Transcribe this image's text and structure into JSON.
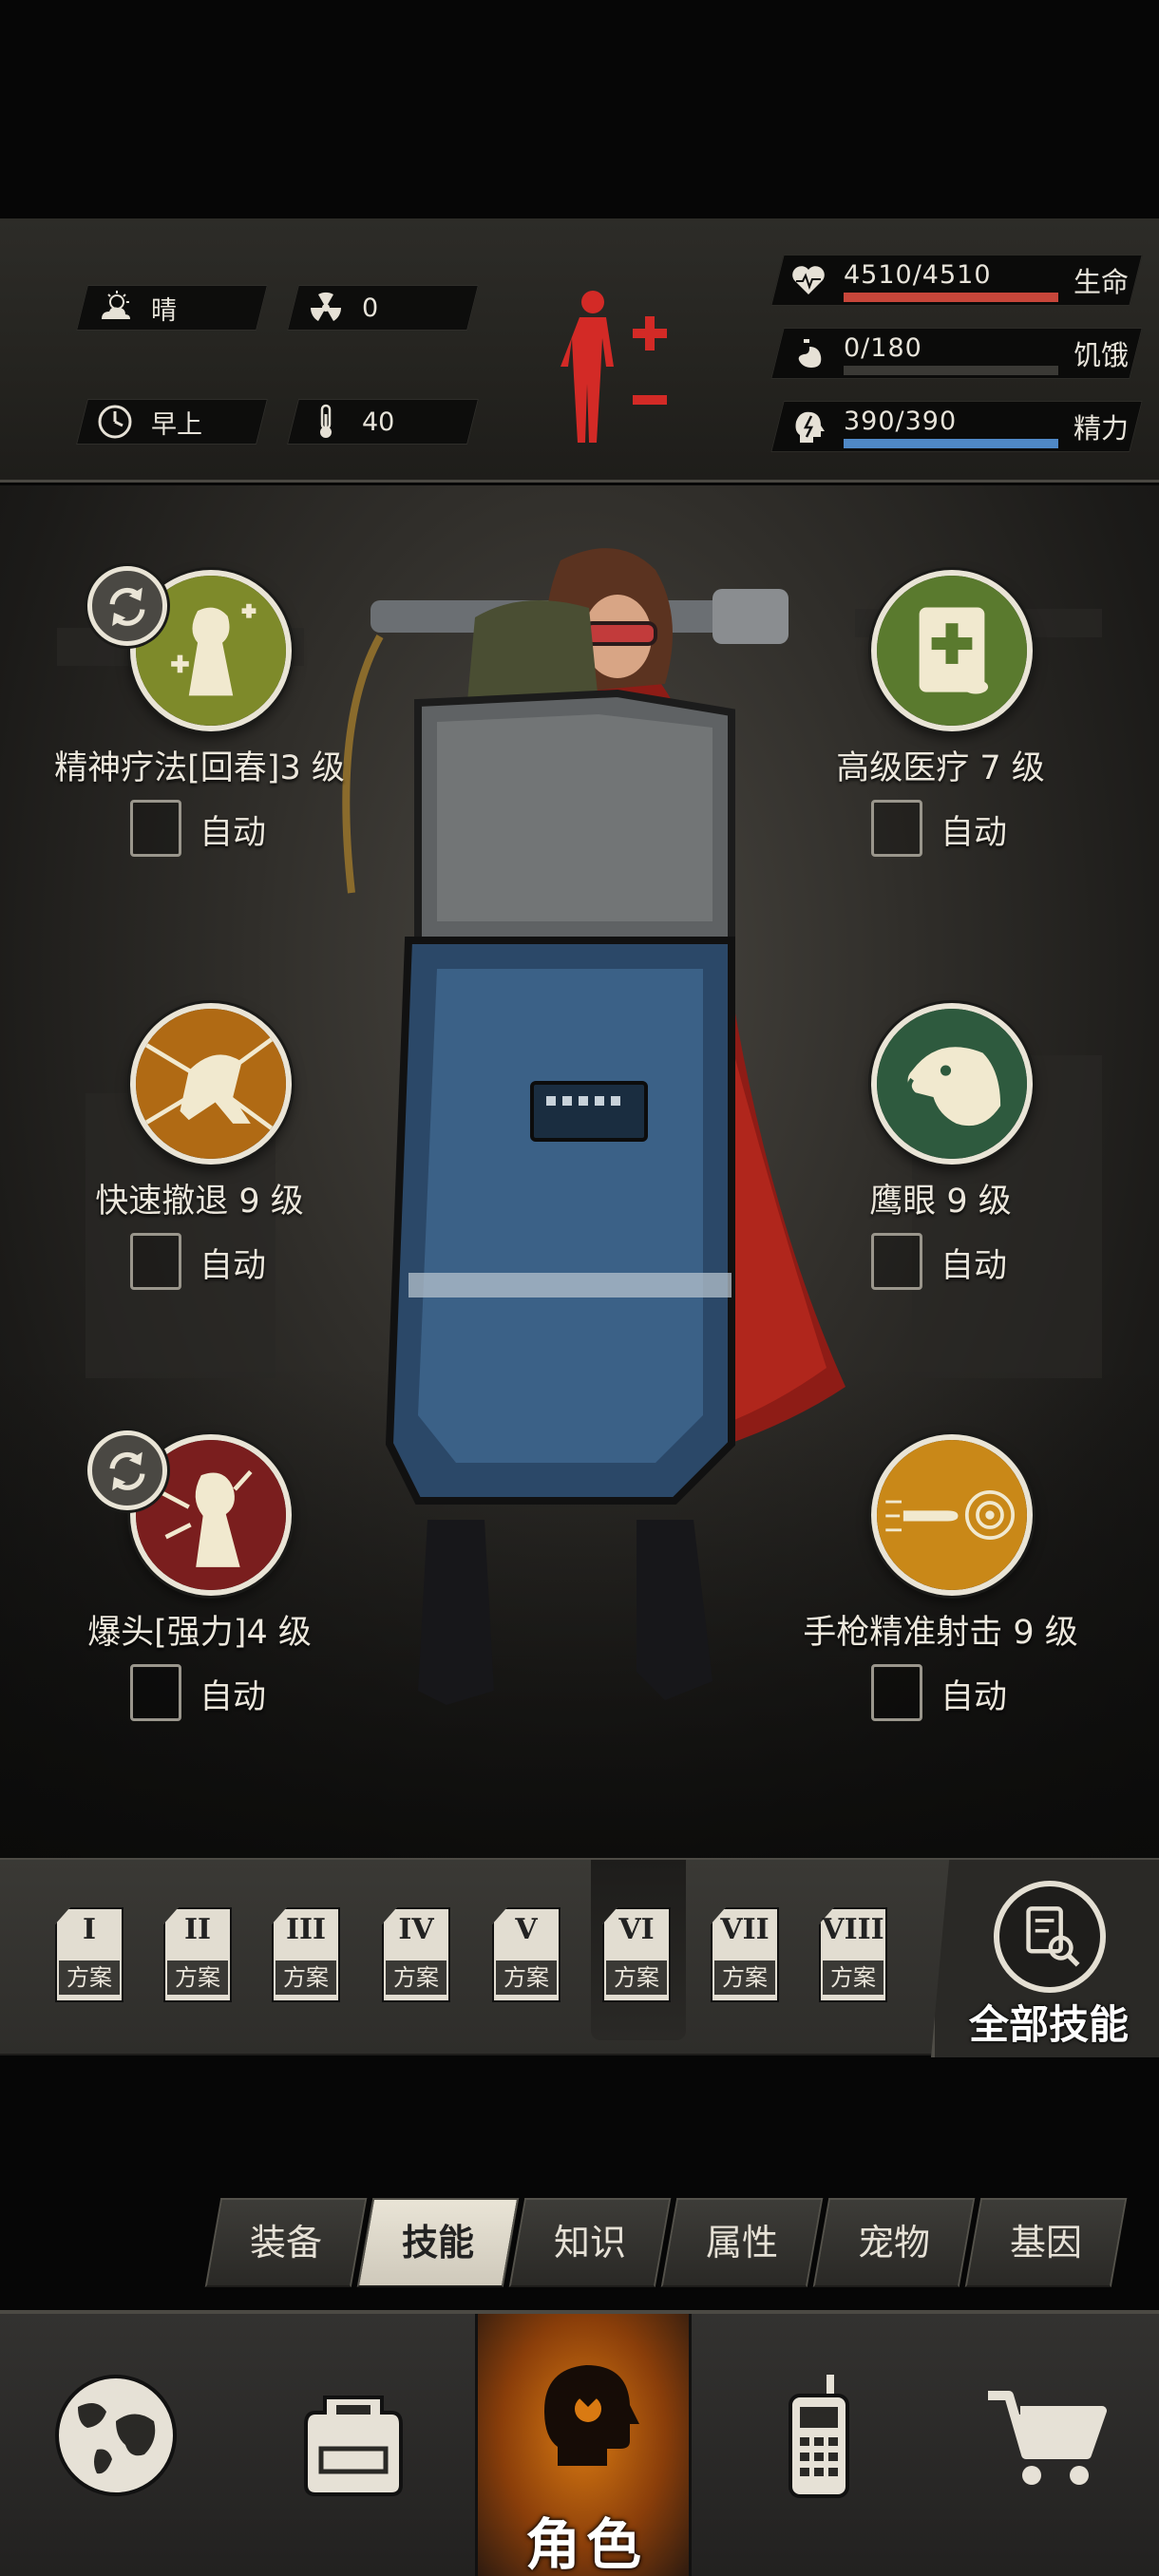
{
  "status": {
    "weather": "晴",
    "radiation": "0",
    "time_of_day": "早上",
    "temperature": "40"
  },
  "vitals": [
    {
      "name": "生命",
      "value": "4510/4510",
      "ratio": 1.0,
      "color": "#c8463a",
      "icon": "heart-pulse-icon"
    },
    {
      "name": "饥饿",
      "value": "0/180",
      "ratio": 0.0,
      "color": "#6d6a63",
      "icon": "stomach-icon"
    },
    {
      "name": "精力",
      "value": "390/390",
      "ratio": 1.0,
      "color": "#4f88c6",
      "icon": "energy-head-icon"
    }
  ],
  "skills": [
    {
      "label": "精神疗法[回春]3 级",
      "auto": "自动",
      "swappable": true,
      "icon": "spirit-therapy-icon"
    },
    {
      "label": "高级医疗 7 级",
      "auto": "自动",
      "swappable": false,
      "icon": "advanced-medical-icon"
    },
    {
      "label": "快速撤退 9 级",
      "auto": "自动",
      "swappable": false,
      "icon": "quick-retreat-icon"
    },
    {
      "label": "鹰眼 9 级",
      "auto": "自动",
      "swappable": false,
      "icon": "eagle-eye-icon"
    },
    {
      "label": "爆头[强力]4 级",
      "auto": "自动",
      "swappable": true,
      "icon": "headshot-icon"
    },
    {
      "label": "手枪精准射击 9 级",
      "auto": "自动",
      "swappable": false,
      "icon": "pistol-precision-icon"
    }
  ],
  "plans": [
    {
      "roman": "I",
      "caption": "方案"
    },
    {
      "roman": "II",
      "caption": "方案"
    },
    {
      "roman": "III",
      "caption": "方案"
    },
    {
      "roman": "IV",
      "caption": "方案"
    },
    {
      "roman": "V",
      "caption": "方案"
    },
    {
      "roman": "VI",
      "caption": "方案"
    },
    {
      "roman": "VII",
      "caption": "方案"
    },
    {
      "roman": "VIII",
      "caption": "方案"
    }
  ],
  "active_plan": "VI",
  "all_skills_label": "全部技能",
  "tabs": [
    "装备",
    "技能",
    "知识",
    "属性",
    "宠物",
    "基因"
  ],
  "active_tab": "技能",
  "nav": {
    "active_label": "角色",
    "items": [
      "globe-icon",
      "backpack-icon",
      "character-icon",
      "radio-icon",
      "cart-icon"
    ]
  },
  "colors": {
    "accent_orange": "#d97a12",
    "health_red": "#c8463a",
    "energy_blue": "#4f88c6"
  }
}
